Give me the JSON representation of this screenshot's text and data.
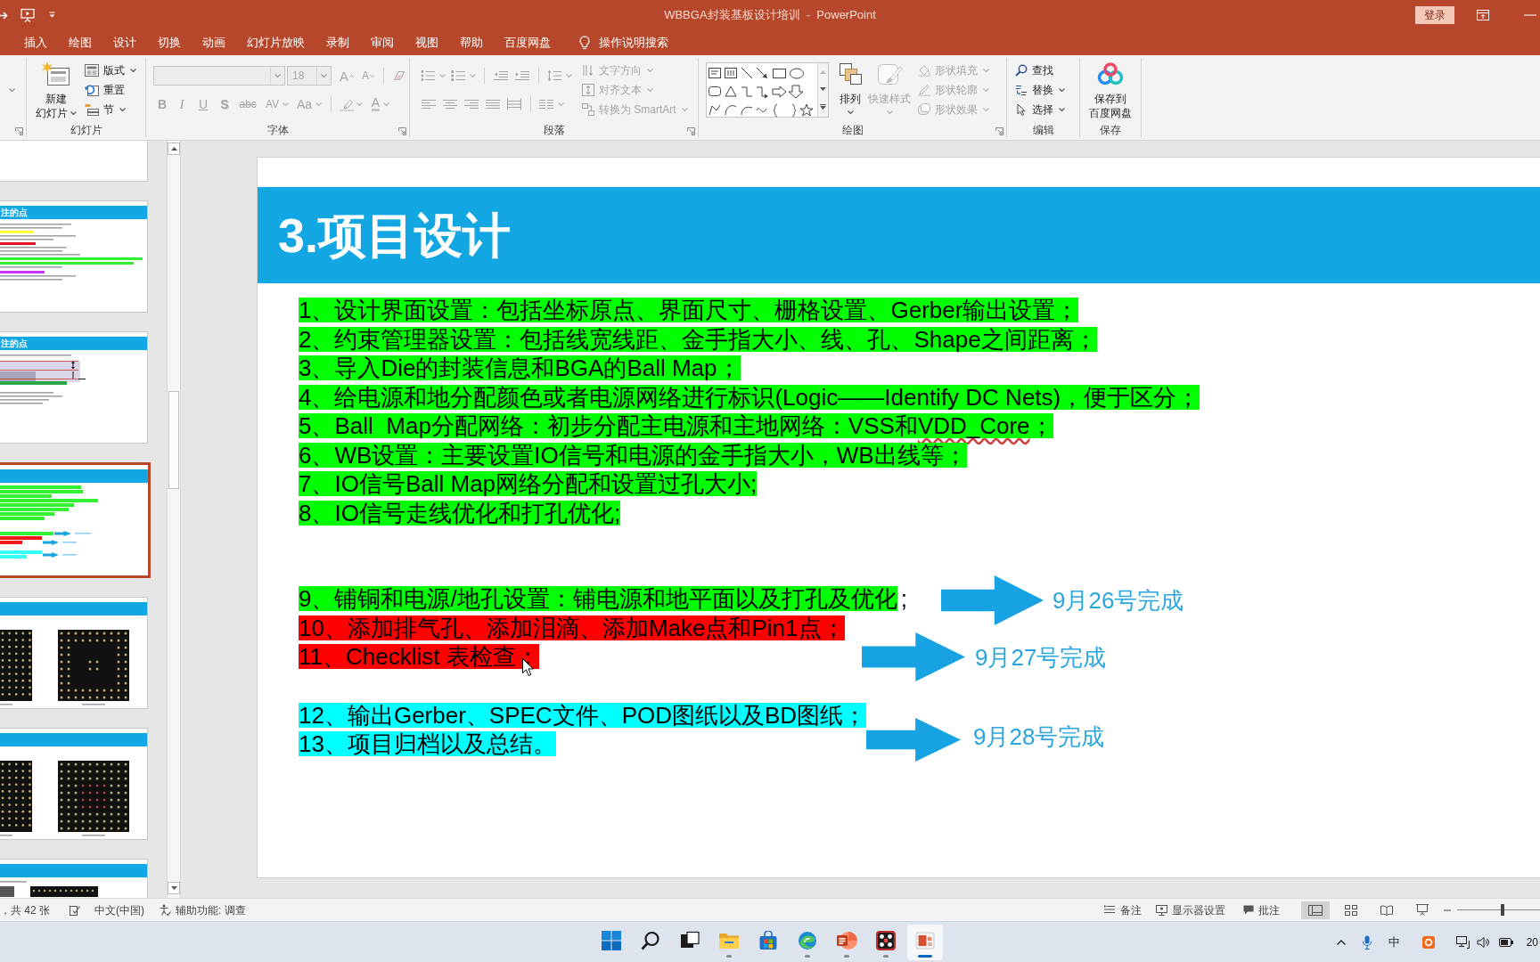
{
  "title_bar": {
    "title": "WBBGA封装基板设计培训  -  PowerPoint",
    "sign_in_button": "登录"
  },
  "ribbon_tabs": [
    {
      "label": "插入",
      "selected": false
    },
    {
      "label": "绘图",
      "selected": false
    },
    {
      "label": "设计",
      "selected": false
    },
    {
      "label": "切换",
      "selected": false
    },
    {
      "label": "动画",
      "selected": false
    },
    {
      "label": "幻灯片放映",
      "selected": false
    },
    {
      "label": "录制",
      "selected": false
    },
    {
      "label": "审阅",
      "selected": false
    },
    {
      "label": "视图",
      "selected": false
    },
    {
      "label": "帮助",
      "selected": false
    },
    {
      "label": "百度网盘",
      "selected": false
    }
  ],
  "tell_me": {
    "label": "操作说明搜索"
  },
  "ribbon": {
    "slides_group": {
      "label": "幻灯片",
      "new_slide": {
        "lines": [
          "新建",
          "幻灯片"
        ],
        "dropdown": true
      },
      "buttons": [
        {
          "kind": "layout",
          "label": "版式",
          "dropdown": true
        },
        {
          "kind": "reset",
          "label": "重置",
          "dropdown": false
        },
        {
          "kind": "section",
          "label": "节",
          "dropdown": true
        }
      ]
    },
    "font_group": {
      "label": "字体",
      "disabled": true,
      "font_size": "18",
      "size_buttons": [
        {
          "kind": "grow",
          "glyph": "A"
        },
        {
          "kind": "shrink",
          "glyph": "A"
        }
      ],
      "format_buttons": [
        {
          "kind": "bold",
          "glyph": "B",
          "dropdown": false
        },
        {
          "kind": "italic",
          "glyph": "I",
          "dropdown": false
        },
        {
          "kind": "underline",
          "glyph": "U",
          "dropdown": false
        },
        {
          "kind": "shadow",
          "glyph": "S",
          "dropdown": false
        },
        {
          "kind": "strikethrough",
          "glyph": "abc",
          "dropdown": false
        },
        {
          "kind": "spacing",
          "glyph": "AV",
          "dropdown": true
        },
        {
          "kind": "case",
          "glyph": "Aa",
          "dropdown": true
        }
      ],
      "font_color_button": {
        "glyph": "A",
        "dropdown": true
      }
    },
    "paragraph_group": {
      "label": "段落",
      "disabled": true,
      "text_buttons": [
        {
          "kind": "text_direction",
          "label": "文字方向"
        },
        {
          "kind": "align_text",
          "label": "对齐文本"
        },
        {
          "kind": "smartart",
          "label": "转换为 SmartArt"
        }
      ]
    },
    "drawing_group": {
      "label": "绘图",
      "arrange_button": {
        "label": "排列",
        "disabled": false
      },
      "quick_styles_button": {
        "label": "快速样式",
        "disabled": true
      },
      "shape_buttons": [
        {
          "kind": "fill",
          "label": "形状填充",
          "disabled": true
        },
        {
          "kind": "outline",
          "label": "形状轮廓",
          "disabled": true
        },
        {
          "kind": "effects",
          "label": "形状效果",
          "disabled": true
        }
      ]
    },
    "editing_group": {
      "label": "编辑",
      "buttons": [
        {
          "kind": "find",
          "label": "查找",
          "dropdown": false
        },
        {
          "kind": "replace",
          "label": "替换",
          "dropdown": true
        },
        {
          "kind": "select",
          "label": "选择",
          "dropdown": true
        }
      ]
    },
    "save_group": {
      "label": "保存",
      "save_button": {
        "lines": [
          "保存到",
          "百度网盘"
        ]
      }
    }
  },
  "thumbnails": [
    {
      "kind": "blank",
      "selected": false
    },
    {
      "kind": "text",
      "title": "注的点",
      "selected": false
    },
    {
      "kind": "diagram",
      "title": "注的点",
      "selected": false
    },
    {
      "kind": "plan",
      "selected": true
    },
    {
      "kind": "bga",
      "selected": false
    },
    {
      "kind": "bga",
      "selected": false
    },
    {
      "kind": "bga_partial",
      "selected": false
    }
  ],
  "slide": {
    "title": "3.项目设计",
    "groups": [
      {
        "lines": [
          {
            "runs": [
              {
                "text": "1、设计界面设置：包括坐标原点、界面尺寸、栅格设置、Gerber输出设置；",
                "color": "#00ff00"
              }
            ]
          },
          {
            "runs": [
              {
                "text": "2、约束管理器设置：包括线宽线距、金手指大小、线、孔、Shape之间距离；",
                "color": "#00ff00"
              }
            ]
          },
          {
            "runs": [
              {
                "text": "3、导入Die的封装信息和BGA的Ball Map；",
                "color": "#00ff00"
              }
            ]
          },
          {
            "runs": [
              {
                "text": "4、给电源和地分配颜色或者电源网络进行标识(Logic——Identify DC Nets)，便于区分；",
                "color": "#00ff00"
              }
            ]
          },
          {
            "runs": [
              {
                "text": "5、Ball  Map分配网络：初步分配主电源和主地网络：VSS和",
                "color": "#00ff00"
              },
              {
                "text": "VDD_Core",
                "color": "#00ff00",
                "misspelled": true
              },
              {
                "text": "；",
                "color": "#00ff00"
              }
            ]
          },
          {
            "runs": [
              {
                "text": "6、WB设置：主要设置IO信号和电源的金手指大小，WB出线等；",
                "color": "#00ff00"
              }
            ]
          },
          {
            "runs": [
              {
                "text": "7、IO信号Ball Map网络分配和设置过孔大小;",
                "color": "#00ff00"
              }
            ]
          },
          {
            "runs": [
              {
                "text": "8、IO信号走线优化和打孔优化;",
                "color": "#00ff00"
              }
            ]
          }
        ]
      },
      {
        "lines": [
          {
            "runs": [
              {
                "text": "9、铺铜和电源/地孔设置：铺电源和地平面以及打孔及优化",
                "color": "#00ff00"
              },
              {
                "text": ";"
              }
            ]
          },
          {
            "runs": [
              {
                "text": "10、添加排气孔、添加泪滴、添加Make点和Pin1点；",
                "color": "#ff0000"
              }
            ]
          },
          {
            "runs": [
              {
                "text": "11、Checklist 表检查；",
                "color": "#ff0000"
              }
            ]
          }
        ]
      },
      {
        "lines": [
          {
            "runs": [
              {
                "text": "12、输出Gerber、SPEC文件、POD图纸以及BD图纸；",
                "color": "#00ffff"
              }
            ]
          },
          {
            "runs": [
              {
                "text": "13、项目归档以及总结。",
                "color": "#00ffff"
              }
            ]
          }
        ]
      }
    ],
    "milestones": [
      {
        "label": "9月26号完成"
      },
      {
        "label": "9月27号完成"
      },
      {
        "label": "9月28号完成"
      }
    ]
  },
  "status_bar": {
    "slide_count": "，共 42 张",
    "language": "中文(中国)",
    "accessibility": "辅助功能: 调查",
    "notes": "备注",
    "display_settings": "显示器设置",
    "comments": "批注",
    "views": [
      {
        "kind": "normal",
        "selected": true
      },
      {
        "kind": "slide_sorter",
        "selected": false
      },
      {
        "kind": "reading",
        "selected": false
      },
      {
        "kind": "slideshow",
        "selected": false
      }
    ],
    "zoom": {
      "level": 0.55
    }
  },
  "taskbar": {
    "apps": [
      {
        "kind": "start",
        "running": false,
        "selected": false
      },
      {
        "kind": "search",
        "running": false,
        "selected": false
      },
      {
        "kind": "task_view",
        "running": false,
        "selected": false
      },
      {
        "kind": "explorer",
        "running": true,
        "selected": false
      },
      {
        "kind": "store",
        "running": false,
        "selected": false
      },
      {
        "kind": "edge",
        "running": true,
        "selected": false
      },
      {
        "kind": "powerpoint",
        "running": true,
        "selected": false
      },
      {
        "kind": "dice_app",
        "running": true,
        "selected": false
      },
      {
        "kind": "slide_app",
        "running": true,
        "selected": true
      }
    ],
    "ime": "中",
    "clock": "20"
  }
}
